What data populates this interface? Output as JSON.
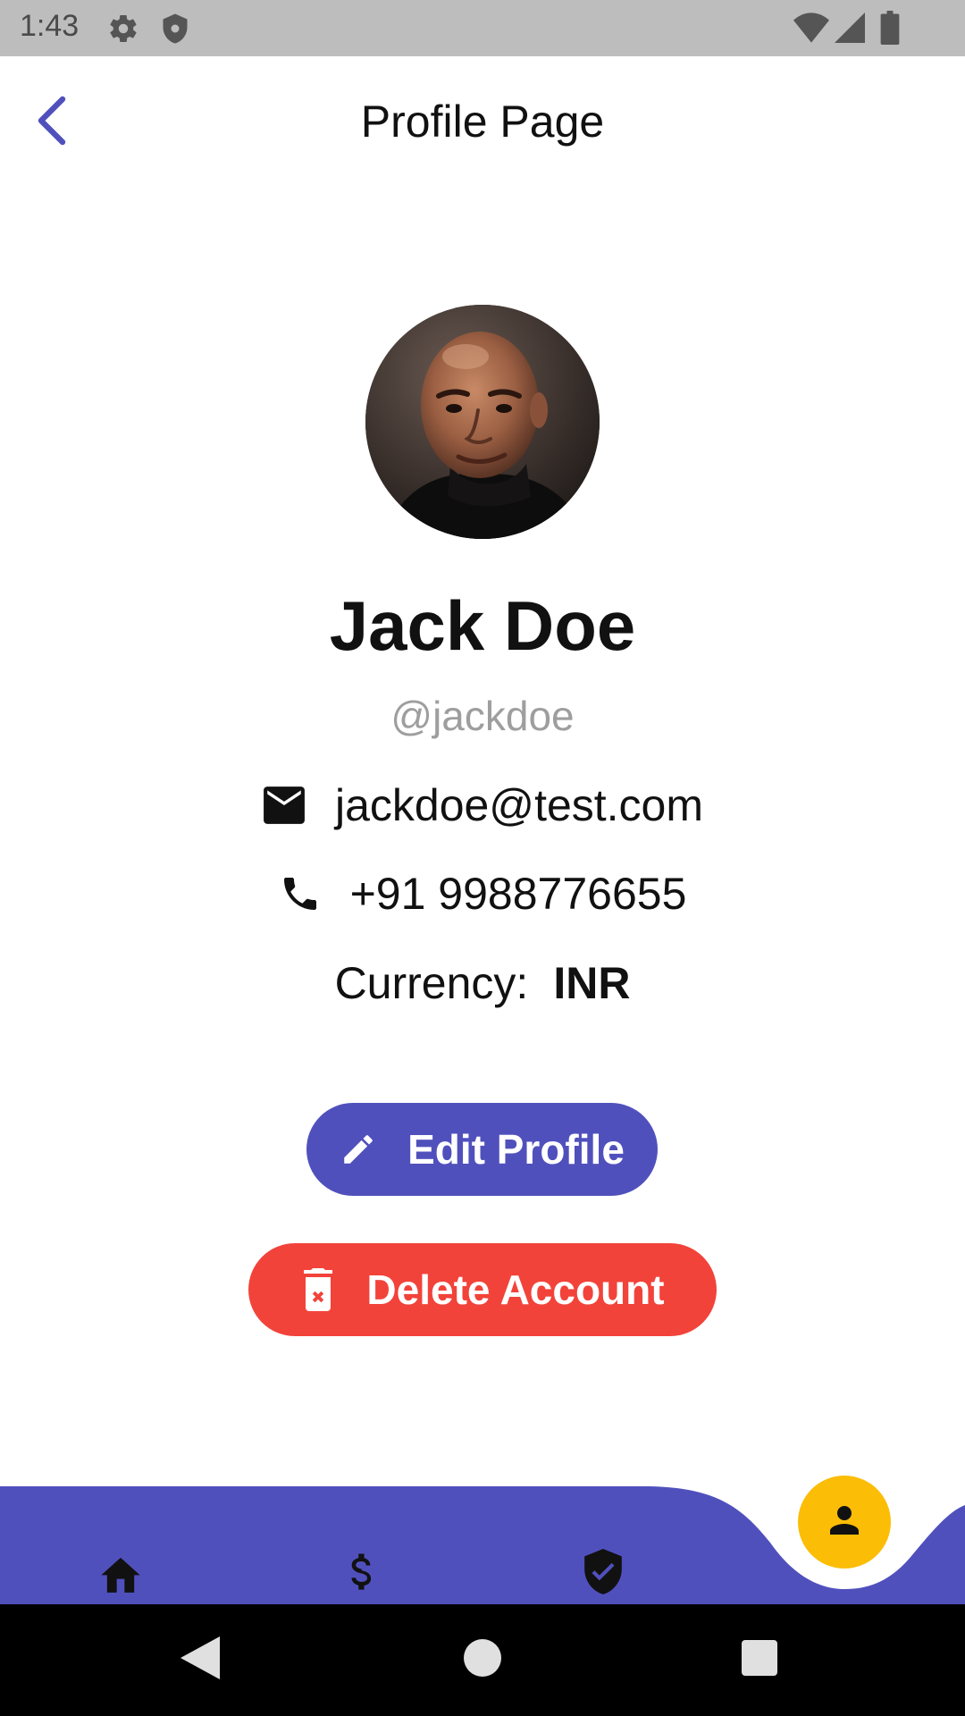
{
  "status_bar": {
    "time": "1:43",
    "icons": [
      "gear-icon",
      "shield-icon",
      "wifi-icon",
      "signal-icon",
      "battery-icon"
    ]
  },
  "app_bar": {
    "title": "Profile Page",
    "back_icon": "chevron-left-icon",
    "back_color": "#5050bd"
  },
  "profile": {
    "name": "Jack Doe",
    "username": "@jackdoe",
    "email": "jackdoe@test.com",
    "phone": "+91 9988776655",
    "currency_label": "Currency:",
    "currency_value": "INR"
  },
  "actions": {
    "edit_label": "Edit Profile",
    "edit_icon": "pencil-icon",
    "edit_color": "#5050bd",
    "delete_label": "Delete Account",
    "delete_icon": "trash-icon",
    "delete_color": "#f2433a"
  },
  "bottom_nav": {
    "bar_color": "#5050bd",
    "fab_color": "#fbbd06",
    "items": [
      {
        "icon": "home-icon"
      },
      {
        "icon": "dollar-icon"
      },
      {
        "icon": "verified-shield-icon"
      },
      {
        "icon": "person-icon",
        "active": true
      }
    ]
  },
  "system_nav": {
    "items": [
      "back-triangle-icon",
      "home-circle-icon",
      "recents-square-icon"
    ]
  }
}
